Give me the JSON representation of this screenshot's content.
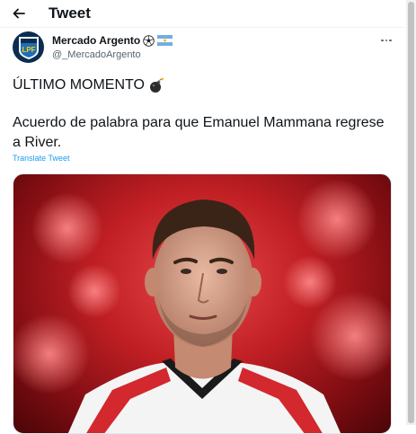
{
  "header": {
    "back_icon": "arrow-left-icon",
    "title": "Tweet"
  },
  "author": {
    "avatar_icon": "lpf-logo-icon",
    "avatar_text": "LPF",
    "name": "Mercado Argento",
    "badges": [
      "soccer-ball-icon",
      "argentina-flag-icon"
    ],
    "handle": "@_MercadoArgento"
  },
  "tweet": {
    "headline": "ÚLTIMO MOMENTO",
    "headline_emoji": "bomb-icon",
    "text": "Acuerdo de palabra para que Emanuel Mammana regrese a River.",
    "translate_label": "Translate Tweet",
    "media_description": "player-photo"
  },
  "colors": {
    "link": "#1d9bf0",
    "secondary_text": "#536471",
    "avatar_bg": "#0b2d52",
    "media_red": "#c01f24"
  }
}
